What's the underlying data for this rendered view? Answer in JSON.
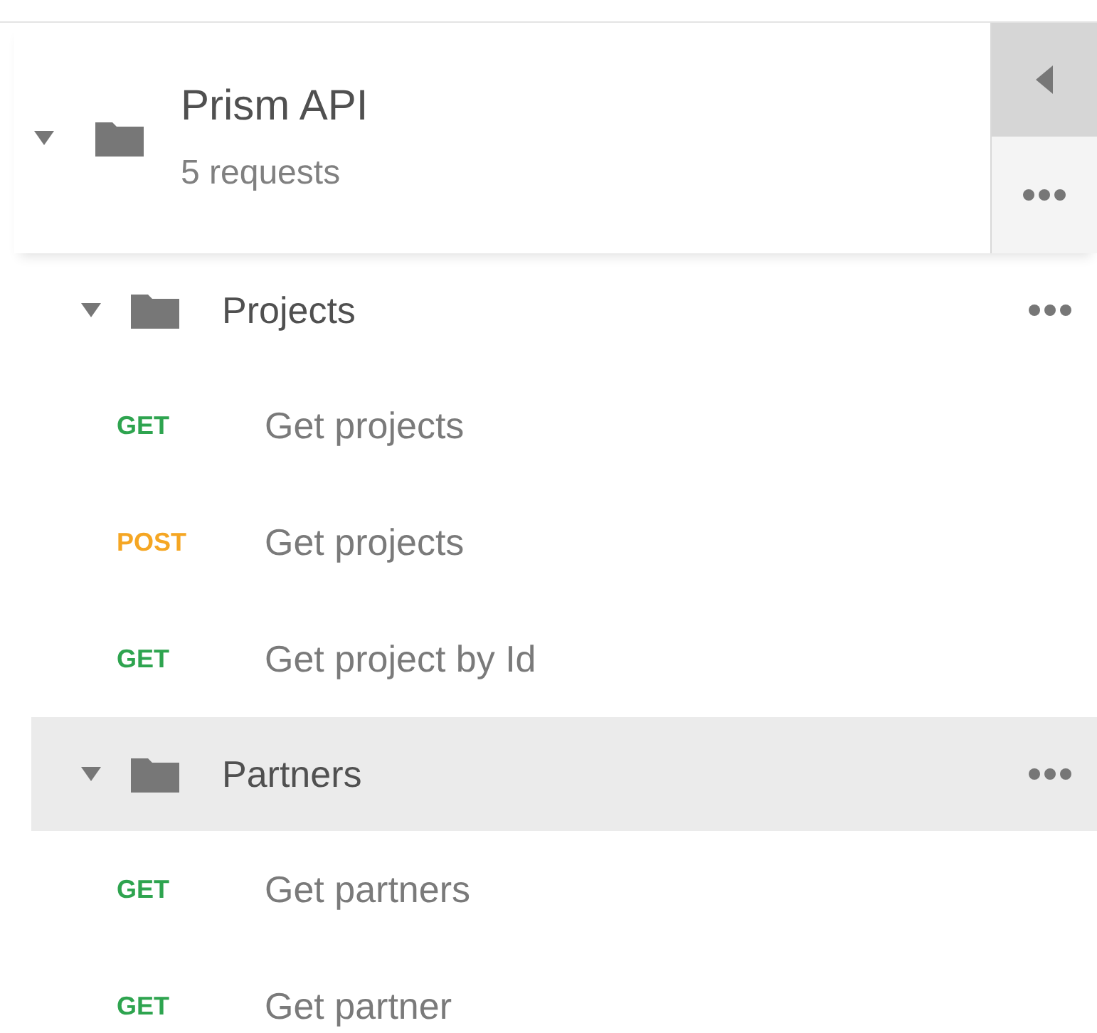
{
  "collection": {
    "name": "Prism API",
    "subtitle": "5 requests",
    "expanded": true
  },
  "folders": [
    {
      "name": "Projects",
      "expanded": true,
      "selected": false,
      "requests": [
        {
          "method": "GET",
          "color": "#2ea44f",
          "name": "Get projects"
        },
        {
          "method": "POST",
          "color": "#f5a623",
          "name": "Get projects"
        },
        {
          "method": "GET",
          "color": "#2ea44f",
          "name": "Get project by Id"
        }
      ]
    },
    {
      "name": "Partners",
      "expanded": true,
      "selected": true,
      "requests": [
        {
          "method": "GET",
          "color": "#2ea44f",
          "name": "Get partners"
        },
        {
          "method": "GET",
          "color": "#2ea44f",
          "name": "Get partner"
        }
      ]
    }
  ]
}
